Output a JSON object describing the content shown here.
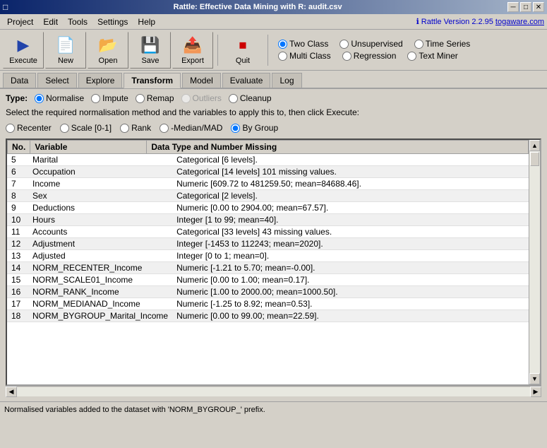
{
  "titleBar": {
    "icon": "□",
    "title": "Rattle: Effective Data Mining with R: audit.csv",
    "minimize": "─",
    "maximize": "□",
    "close": "✕"
  },
  "menuBar": {
    "items": [
      "Project",
      "Edit",
      "Tools",
      "Settings",
      "Help"
    ],
    "info": "ℹ Rattle Version 2.2.95 togaware.com"
  },
  "toolbar": {
    "execute_label": "Execute",
    "new_label": "New",
    "open_label": "Open",
    "save_label": "Save",
    "export_label": "Export",
    "quit_label": "Quit"
  },
  "radioGroup": {
    "row1": [
      {
        "id": "twoclass",
        "label": "Two Class",
        "checked": true
      },
      {
        "id": "unsupervised",
        "label": "Unsupervised",
        "checked": false
      },
      {
        "id": "timeseries",
        "label": "Time Series",
        "checked": false
      }
    ],
    "row2": [
      {
        "id": "multiclass",
        "label": "Multi Class",
        "checked": false
      },
      {
        "id": "regression",
        "label": "Regression",
        "checked": false
      },
      {
        "id": "textminer",
        "label": "Text Miner",
        "checked": false
      }
    ]
  },
  "tabs": [
    "Data",
    "Select",
    "Explore",
    "Transform",
    "Model",
    "Evaluate",
    "Log"
  ],
  "activeTab": "Transform",
  "typeRow": {
    "label": "Type:",
    "options": [
      {
        "id": "normalise",
        "label": "Normalise",
        "checked": true
      },
      {
        "id": "impute",
        "label": "Impute",
        "checked": false
      },
      {
        "id": "remap",
        "label": "Remap",
        "checked": false
      },
      {
        "id": "outliers",
        "label": "Outliers",
        "checked": false
      },
      {
        "id": "cleanup",
        "label": "Cleanup",
        "checked": false
      }
    ]
  },
  "description": "Select the required normalisation method and the variables to apply this to, then click Execute:",
  "normaliseOptions": [
    {
      "id": "recenter",
      "label": "Recenter",
      "checked": false
    },
    {
      "id": "scale01",
      "label": "Scale [0-1]",
      "checked": false
    },
    {
      "id": "rank",
      "label": "Rank",
      "checked": false
    },
    {
      "id": "medianmad",
      "label": "-Median/MAD",
      "checked": false
    },
    {
      "id": "bygroup",
      "label": "By Group",
      "checked": true
    }
  ],
  "table": {
    "columns": [
      "No.",
      "Variable",
      "Data Type and Number Missing"
    ],
    "rows": [
      {
        "no": "5",
        "variable": "Marital",
        "description": "Categorical [6 levels]."
      },
      {
        "no": "6",
        "variable": "Occupation",
        "description": "Categorical [14 levels] 101 missing values."
      },
      {
        "no": "7",
        "variable": "Income",
        "description": "Numeric [609.72 to 481259.50; mean=84688.46]."
      },
      {
        "no": "8",
        "variable": "Sex",
        "description": "Categorical [2 levels]."
      },
      {
        "no": "9",
        "variable": "Deductions",
        "description": "Numeric [0.00 to 2904.00; mean=67.57]."
      },
      {
        "no": "10",
        "variable": "Hours",
        "description": "Integer [1 to 99; mean=40]."
      },
      {
        "no": "11",
        "variable": "Accounts",
        "description": "Categorical [33 levels] 43 missing values."
      },
      {
        "no": "12",
        "variable": "Adjustment",
        "description": "Integer [-1453 to 112243; mean=2020]."
      },
      {
        "no": "13",
        "variable": "Adjusted",
        "description": "Integer [0 to 1; mean=0]."
      },
      {
        "no": "14",
        "variable": "NORM_RECENTER_Income",
        "description": "Numeric [-1.21 to 5.70; mean=-0.00]."
      },
      {
        "no": "15",
        "variable": "NORM_SCALE01_Income",
        "description": "Numeric [0.00 to 1.00; mean=0.17]."
      },
      {
        "no": "16",
        "variable": "NORM_RANK_Income",
        "description": "Numeric [1.00 to 2000.00; mean=1000.50]."
      },
      {
        "no": "17",
        "variable": "NORM_MEDIANAD_Income",
        "description": "Numeric [-1.25 to 8.92; mean=0.53]."
      },
      {
        "no": "18",
        "variable": "NORM_BYGROUP_Marital_Income",
        "description": "Numeric [0.00 to 99.00; mean=22.59]."
      }
    ]
  },
  "statusBar": "Normalised variables added to the dataset with 'NORM_BYGROUP_' prefix."
}
